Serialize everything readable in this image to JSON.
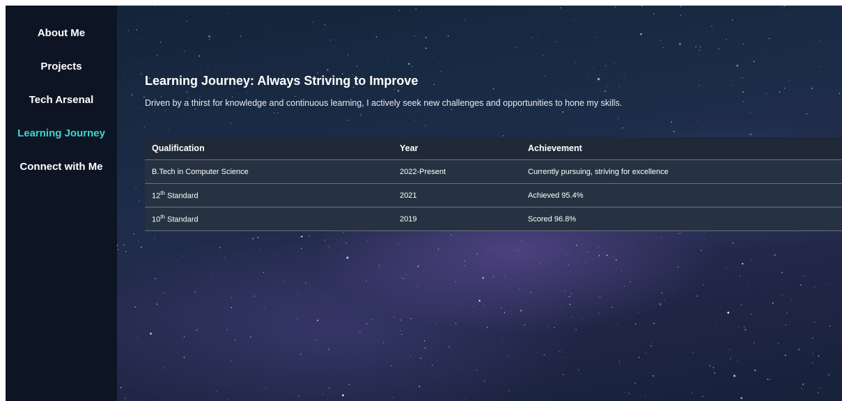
{
  "sidebar": {
    "items": [
      {
        "label": "About Me",
        "active": false
      },
      {
        "label": "Projects",
        "active": false
      },
      {
        "label": "Tech Arsenal",
        "active": false
      },
      {
        "label": "Learning Journey",
        "active": true
      },
      {
        "label": "Connect with Me",
        "active": false
      }
    ]
  },
  "section": {
    "title": "Learning Journey: Always Striving to Improve",
    "intro": "Driven by a thirst for knowledge and continuous learning, I actively seek new challenges and opportunities to hone my skills."
  },
  "table": {
    "headers": {
      "qualification": "Qualification",
      "year": "Year",
      "achievement": "Achievement"
    },
    "rows": [
      {
        "qualification": "B.Tech in Computer Science",
        "qualification_sup": "",
        "qualification_suffix": "",
        "year": "2022-Present",
        "achievement": "Currently pursuing, striving for excellence"
      },
      {
        "qualification": "12",
        "qualification_sup": "th",
        "qualification_suffix": " Standard",
        "year": "2021",
        "achievement": "Achieved 95.4%"
      },
      {
        "qualification": "10",
        "qualification_sup": "th",
        "qualification_suffix": " Standard",
        "year": "2019",
        "achievement": "Scored 96.8%"
      }
    ]
  },
  "colors": {
    "sidebar_bg": "#0d1524",
    "active_nav": "#3fd6d0",
    "table_header_bg": "#1f2937",
    "table_row_bg": "#263241"
  }
}
